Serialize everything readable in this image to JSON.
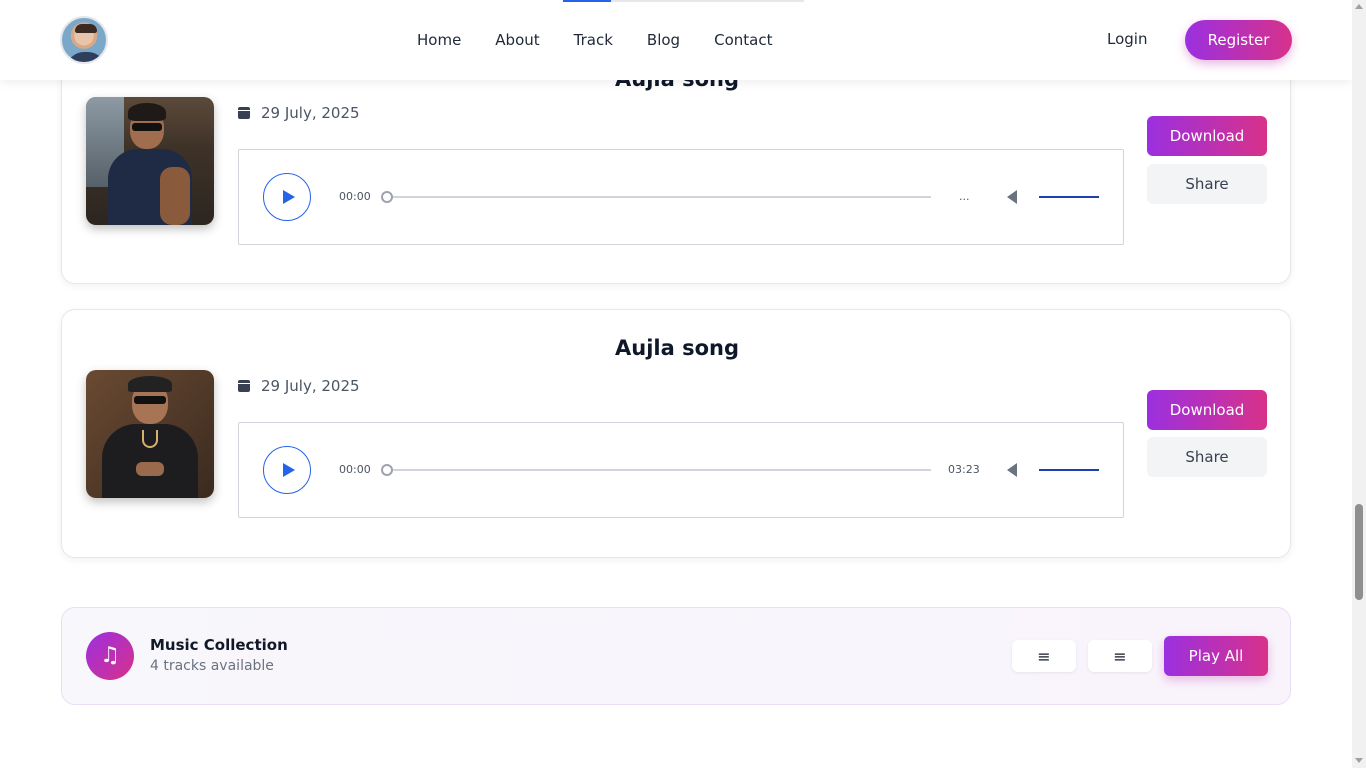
{
  "header": {
    "nav": [
      "Home",
      "About",
      "Track",
      "Blog",
      "Contact"
    ],
    "login_label": "Login",
    "register_label": "Register"
  },
  "tracks": [
    {
      "title": "Aujla song",
      "date": "29 July, 2025",
      "current_time": "00:00",
      "duration": "...",
      "download_label": "Download",
      "share_label": "Share"
    },
    {
      "title": "Aujla song",
      "date": "29 July, 2025",
      "current_time": "00:00",
      "duration": "03:23",
      "download_label": "Download",
      "share_label": "Share"
    }
  ],
  "collection": {
    "title": "Music Collection",
    "subtitle": "4 tracks available",
    "list_icon_1": "≡",
    "list_icon_2": "≡",
    "play_all_label": "Play All",
    "music_icon": "♫"
  },
  "colors": {
    "accent_start": "#9b30e0",
    "accent_end": "#d8318a",
    "player_blue": "#2563eb"
  }
}
